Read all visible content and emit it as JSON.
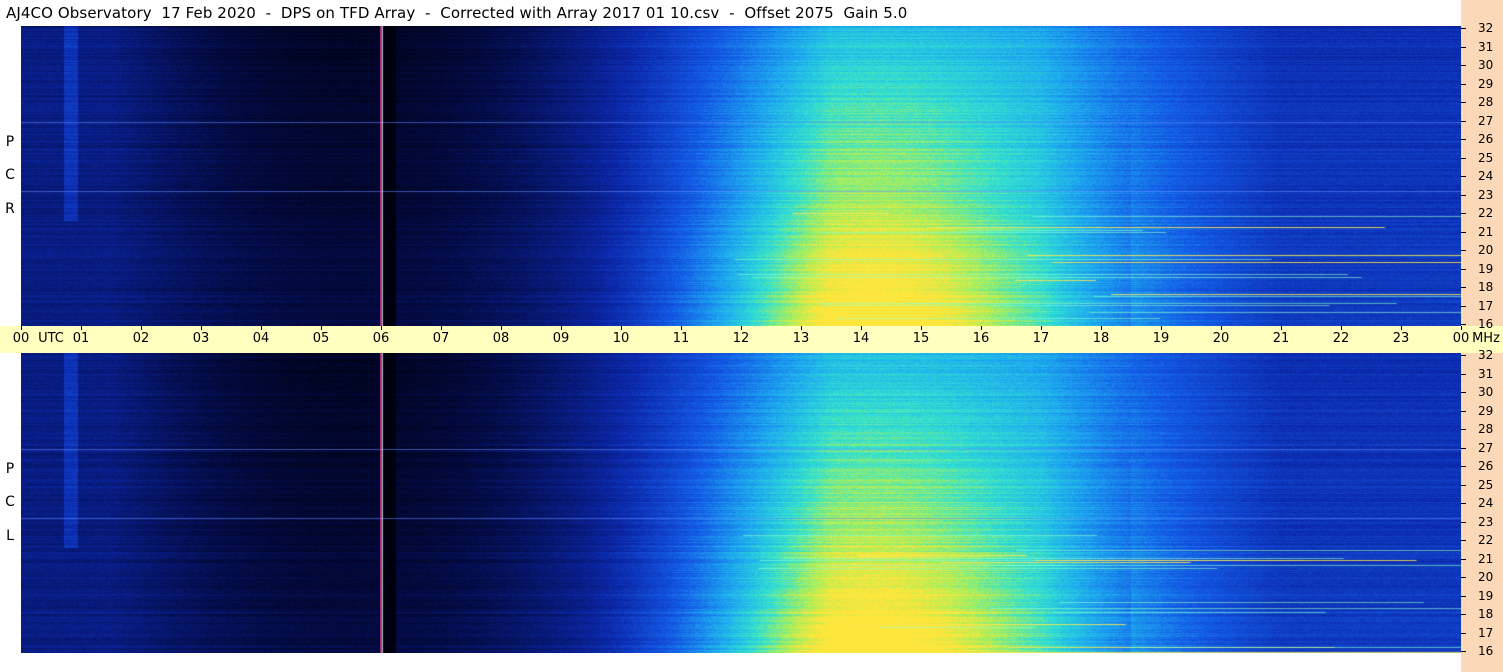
{
  "title": "AJ4CO Observatory  17 Feb 2020  -  DPS on TFD Array  -  Corrected with Array 2017 01 10.csv  -  Offset 2075  Gain 5.0",
  "panels": [
    {
      "polarization": "RCP",
      "letters": [
        "R",
        "C",
        "P"
      ]
    },
    {
      "polarization": "LCP",
      "letters": [
        "L",
        "C",
        "P"
      ]
    }
  ],
  "time_axis": {
    "unit_label": "UTC",
    "ticks": [
      "00",
      "01",
      "02",
      "03",
      "04",
      "05",
      "06",
      "07",
      "08",
      "09",
      "10",
      "11",
      "12",
      "13",
      "14",
      "15",
      "16",
      "17",
      "18",
      "19",
      "20",
      "21",
      "22",
      "23",
      "00"
    ],
    "freq_unit": "MHz"
  },
  "freq_axis": {
    "ticks": [
      "32",
      "31",
      "30",
      "29",
      "28",
      "27",
      "26",
      "25",
      "24",
      "23",
      "22",
      "21",
      "20",
      "19",
      "18",
      "17",
      "16"
    ]
  },
  "colors": {
    "background": "#0a1e8c",
    "quiet": "#000010",
    "active": "#30e0d0",
    "hot": "#ffe040",
    "axis_band": "#ffffc0",
    "side_bar": "#fbd9b8"
  }
}
